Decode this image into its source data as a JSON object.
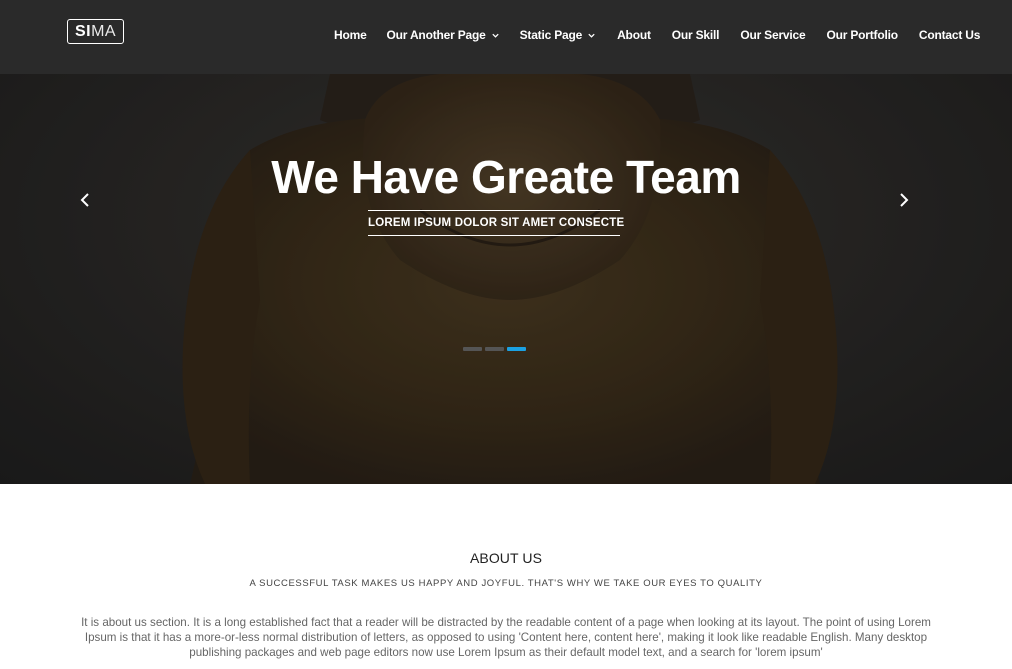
{
  "logo": {
    "bold": "SI",
    "light": "MA"
  },
  "nav": {
    "items": [
      {
        "label": "Home",
        "dropdown": false
      },
      {
        "label": "Our Another Page",
        "dropdown": true
      },
      {
        "label": "Static Page",
        "dropdown": true
      },
      {
        "label": "About",
        "dropdown": false
      },
      {
        "label": "Our Skill",
        "dropdown": false
      },
      {
        "label": "Our Service",
        "dropdown": false
      },
      {
        "label": "Our Portfolio",
        "dropdown": false
      },
      {
        "label": "Contact Us",
        "dropdown": false
      }
    ]
  },
  "hero": {
    "title": "We Have Greate Team",
    "subtitle": "LOREM IPSUM DOLOR SIT AMET CONSECTE",
    "prev_icon": "chevron-left-icon",
    "next_icon": "chevron-right-icon",
    "slides_count": 3,
    "active_slide": 3
  },
  "about": {
    "title": "ABOUT US",
    "tagline": "A SUCCESSFUL TASK MAKES US HAPPY AND JOYFUL. THAT'S WHY WE TAKE OUR EYES TO QUALITY",
    "text": "It is about us section. It is a long established fact that a reader will be distracted by the readable content of a page when looking at its layout. The point of using Lorem Ipsum is that it has a more-or-less normal distribution of letters, as opposed to using 'Content here, content here', making it look like readable English. Many desktop publishing packages and web page editors now use Lorem Ipsum as their default model text, and a search for 'lorem ipsum'"
  },
  "colors": {
    "accent": "#1ba1e2",
    "hero_bg": "#2e2c2a",
    "nav_text": "#ffffff"
  }
}
